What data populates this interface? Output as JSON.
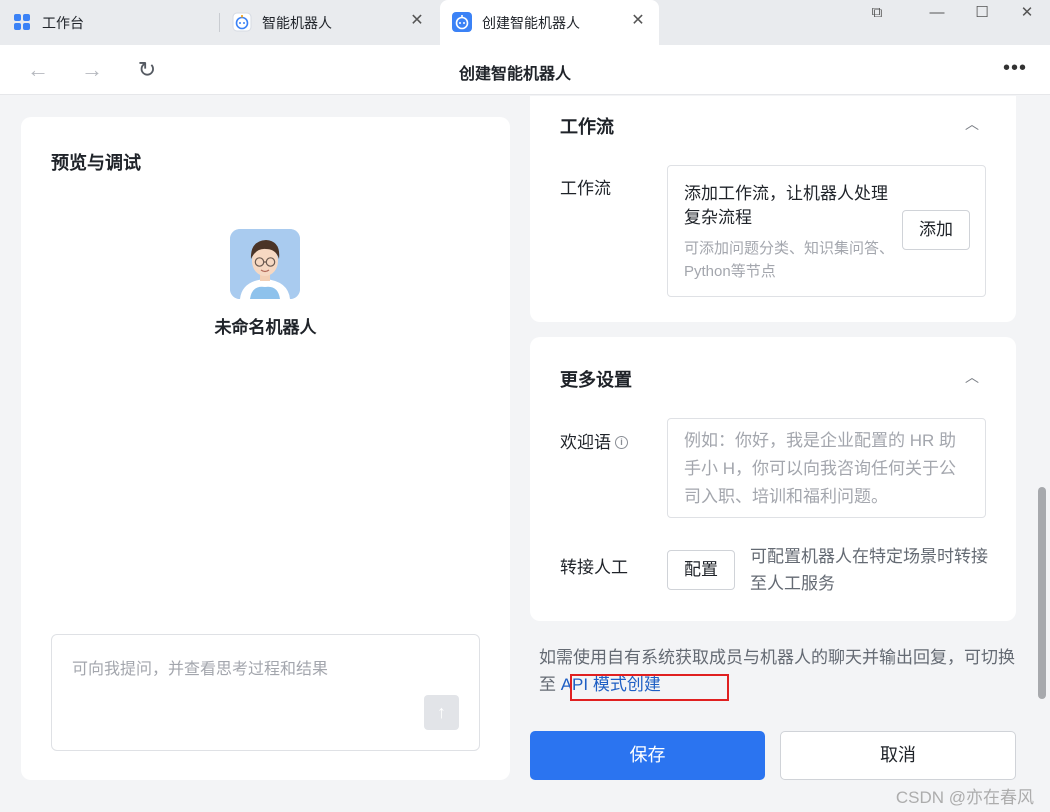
{
  "tabs": [
    {
      "label": "工作台",
      "icon": "grid-icon"
    },
    {
      "label": "智能机器人",
      "icon": "robot-icon",
      "close": "✕"
    },
    {
      "label": "创建智能机器人",
      "icon": "robot-icon",
      "close": "✕"
    }
  ],
  "window_controls": {
    "restore_tab": "⧉",
    "minimize": "—",
    "maximize": "☐",
    "close": "✕"
  },
  "nav": {
    "back": "←",
    "forward": "→",
    "refresh": "↻",
    "title": "创建智能机器人",
    "more": "•••"
  },
  "preview": {
    "title": "预览与调试",
    "bot_name": "未命名机器人",
    "input_placeholder": "可向我提问，并查看思考过程和结果",
    "send": "↑"
  },
  "workflow_card": {
    "title": "工作流",
    "collapse": "︿",
    "field_label": "工作流",
    "box_title": "添加工作流，让机器人处理复杂流程",
    "box_desc": "可添加问题分类、知识集问答、Python等节点",
    "add_button": "添加"
  },
  "more_settings": {
    "title": "更多设置",
    "collapse": "︿",
    "welcome_label": "欢迎语",
    "info": "i",
    "welcome_placeholder": "例如：你好，我是企业配置的 HR 助手小 H，你可以向我咨询任何关于公司入职、培训和福利问题。",
    "transfer_label": "转接人工",
    "config_button": "配置",
    "config_desc": "可配置机器人在特定场景时转接至人工服务"
  },
  "api_note": {
    "text": "如需使用自有系统获取成员与机器人的聊天并输出回复，可切换至",
    "link": " API 模式创建"
  },
  "footer": {
    "save": "保存",
    "cancel": "取消"
  },
  "watermark": "CSDN @亦在春风",
  "colors": {
    "primary": "#2b74f0",
    "link": "#1f5fc4",
    "highlight": "#e02020"
  }
}
